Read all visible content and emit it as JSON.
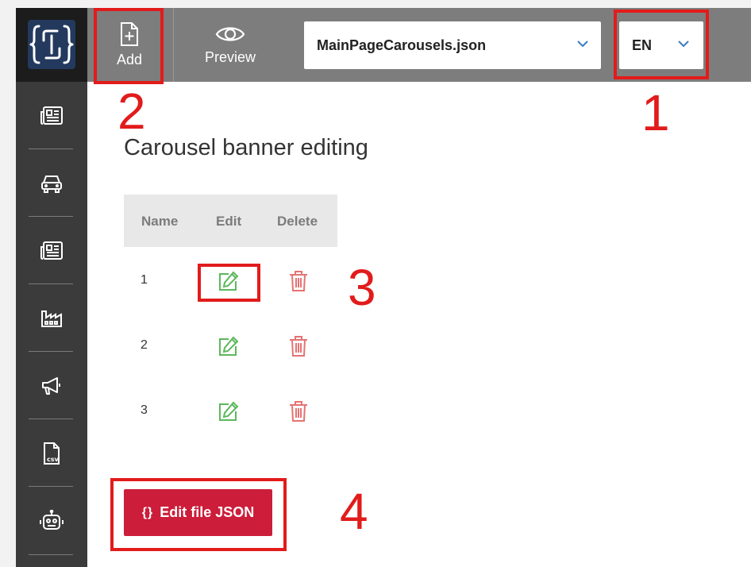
{
  "toolbar": {
    "add_label": "Add",
    "preview_label": "Preview"
  },
  "file_select": {
    "value": "MainPageCarousels.json"
  },
  "lang_select": {
    "value": "EN"
  },
  "page": {
    "title": "Carousel banner editing"
  },
  "table": {
    "headers": [
      "Name",
      "Edit",
      "Delete"
    ],
    "rows": [
      {
        "name": "1"
      },
      {
        "name": "2"
      },
      {
        "name": "3"
      }
    ]
  },
  "edit_json_button": {
    "label": "Edit file JSON"
  },
  "annotations": {
    "n1": "1",
    "n2": "2",
    "n3": "3",
    "n4": "4"
  },
  "icons": {
    "nav": [
      "newspaper-icon",
      "car-icon",
      "newspaper-icon",
      "factory-icon",
      "megaphone-icon",
      "csv-file-icon",
      "robot-icon"
    ]
  },
  "colors": {
    "sidebar": "#3b3b3b",
    "topbar": "#7d7d7d",
    "accent_red": "#cc1d3a",
    "annotation_red": "#e21b1b",
    "edit_green": "#5cb85c",
    "delete_red": "#e57373",
    "chevron_blue": "#3a7bbf"
  }
}
